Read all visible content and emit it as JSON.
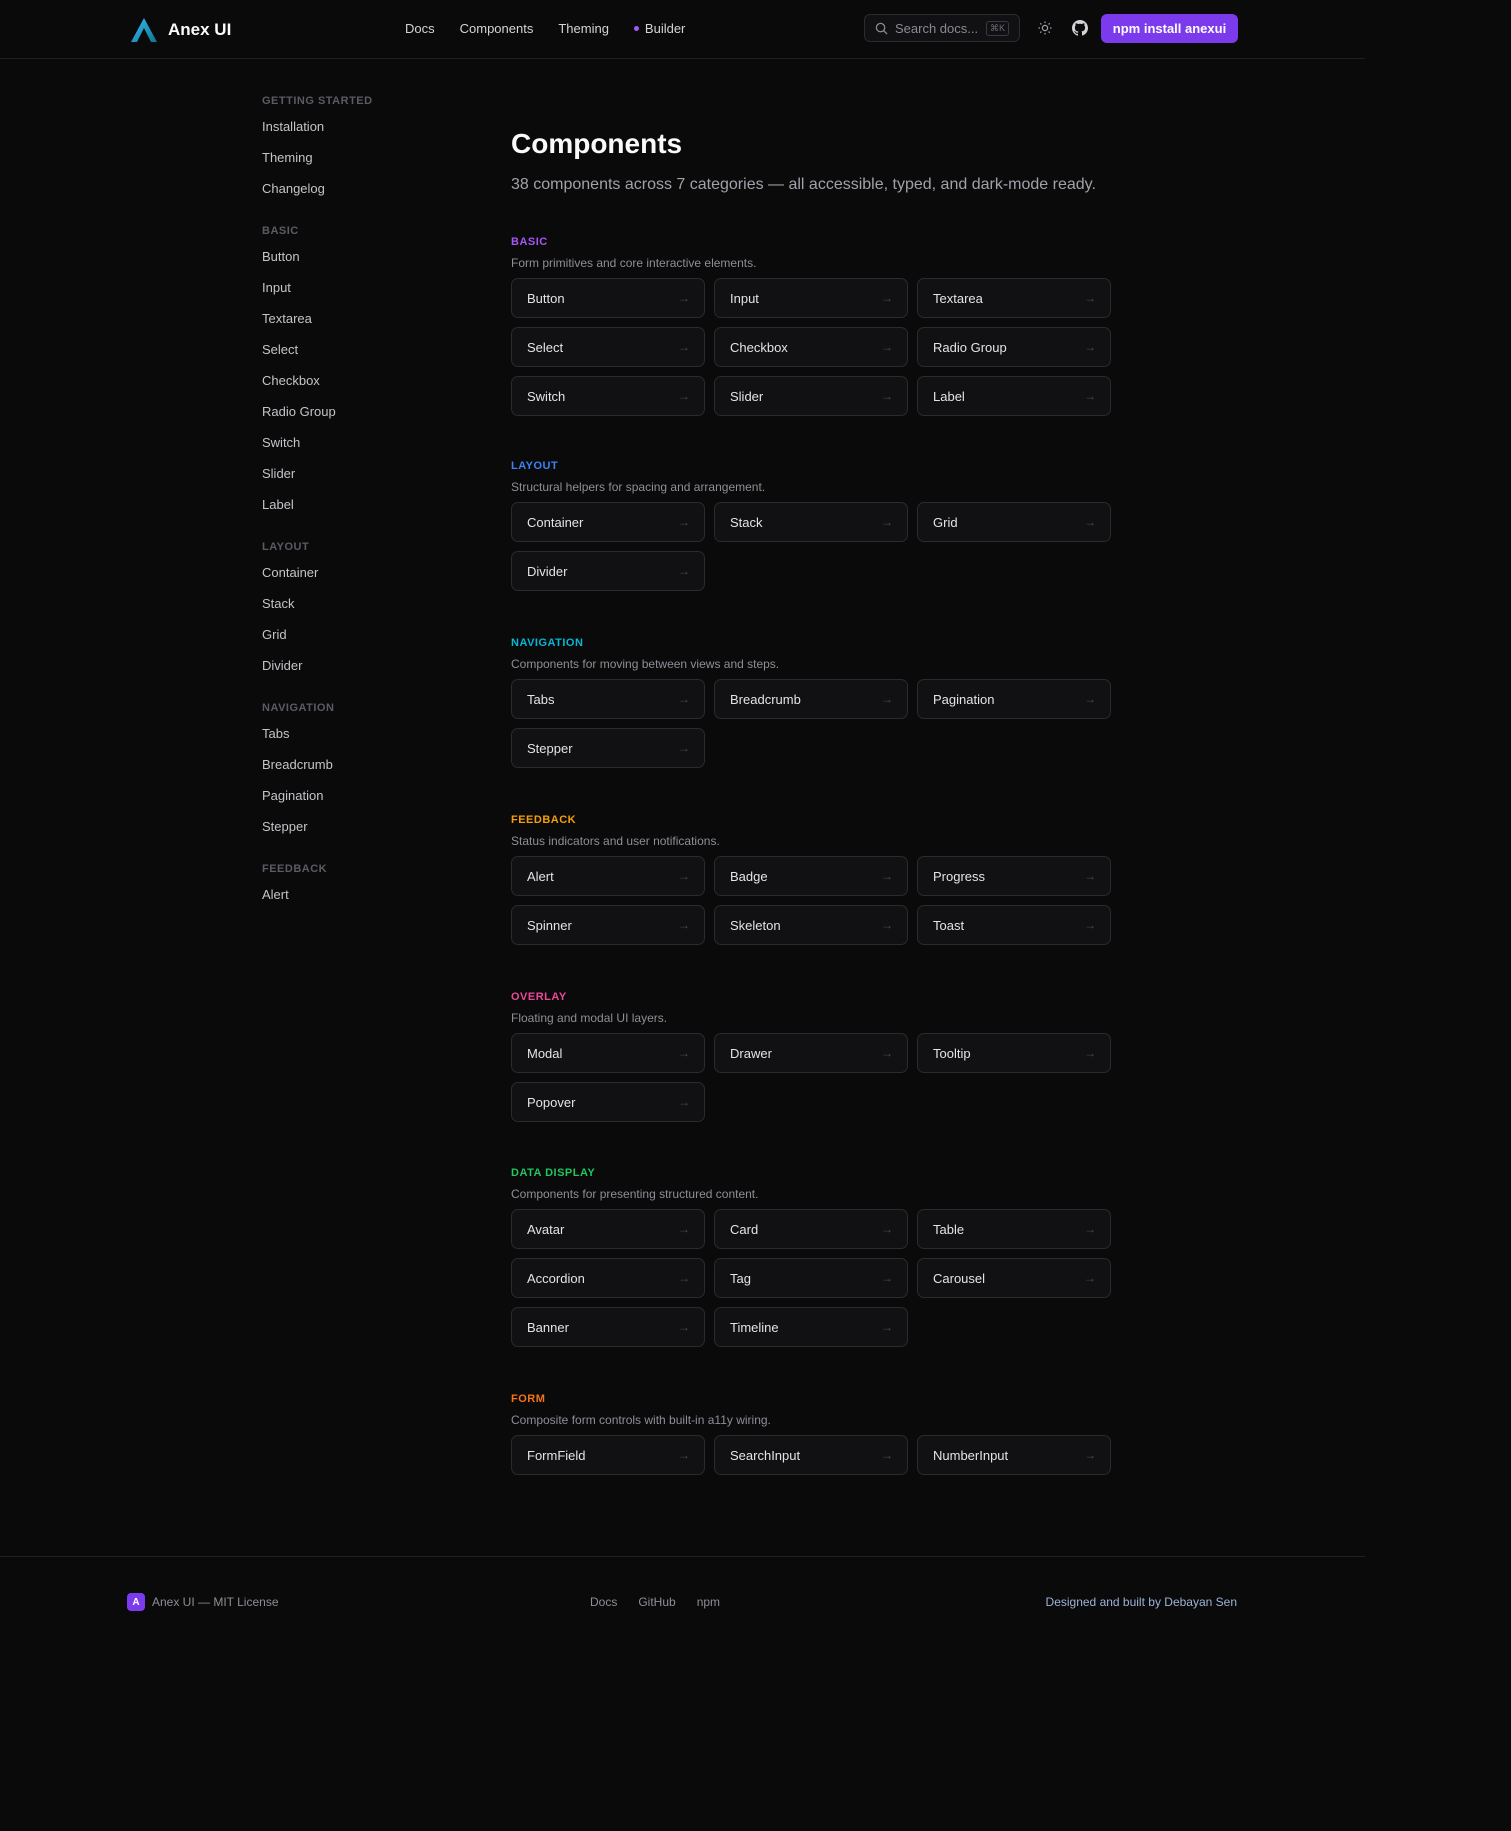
{
  "header": {
    "brand": "Anex UI",
    "nav": [
      "Docs",
      "Components",
      "Theming",
      "Builder"
    ],
    "search_placeholder": "Search docs...",
    "search_shortcut": "⌘K",
    "cta": "npm install anexui"
  },
  "sidebar": {
    "groups": [
      {
        "title": "GETTING STARTED",
        "items": [
          "Installation",
          "Theming",
          "Changelog"
        ]
      },
      {
        "title": "BASIC",
        "items": [
          "Button",
          "Input",
          "Textarea",
          "Select",
          "Checkbox",
          "Radio Group",
          "Switch",
          "Slider",
          "Label"
        ]
      },
      {
        "title": "LAYOUT",
        "items": [
          "Container",
          "Stack",
          "Grid",
          "Divider"
        ]
      },
      {
        "title": "NAVIGATION",
        "items": [
          "Tabs",
          "Breadcrumb",
          "Pagination",
          "Stepper"
        ]
      },
      {
        "title": "FEEDBACK",
        "items": [
          "Alert"
        ]
      }
    ]
  },
  "main": {
    "title": "Components",
    "subtitle": "38 components across 7 categories — all accessible, typed, and dark-mode ready.",
    "sections": [
      {
        "title": "BASIC",
        "color": "#a855f7",
        "description": "Form primitives and core interactive elements.",
        "items": [
          "Button",
          "Input",
          "Textarea",
          "Select",
          "Checkbox",
          "Radio Group",
          "Switch",
          "Slider",
          "Label"
        ]
      },
      {
        "title": "LAYOUT",
        "color": "#3b82f6",
        "description": "Structural helpers for spacing and arrangement.",
        "items": [
          "Container",
          "Stack",
          "Grid",
          "Divider"
        ]
      },
      {
        "title": "NAVIGATION",
        "color": "#06b6d4",
        "description": "Components for moving between views and steps.",
        "items": [
          "Tabs",
          "Breadcrumb",
          "Pagination",
          "Stepper"
        ]
      },
      {
        "title": "FEEDBACK",
        "color": "#f59e0b",
        "description": "Status indicators and user notifications.",
        "items": [
          "Alert",
          "Badge",
          "Progress",
          "Spinner",
          "Skeleton",
          "Toast"
        ]
      },
      {
        "title": "OVERLAY",
        "color": "#ec4899",
        "description": "Floating and modal UI layers.",
        "items": [
          "Modal",
          "Drawer",
          "Tooltip",
          "Popover"
        ]
      },
      {
        "title": "DATA DISPLAY",
        "color": "#22c55e",
        "description": "Components for presenting structured content.",
        "items": [
          "Avatar",
          "Card",
          "Table",
          "Accordion",
          "Tag",
          "Carousel",
          "Banner",
          "Timeline"
        ]
      },
      {
        "title": "FORM",
        "color": "#f97316",
        "description": "Composite form controls with built-in a11y wiring.",
        "items": [
          "FormField",
          "SearchInput",
          "NumberInput"
        ]
      }
    ],
    "arrow": "→"
  },
  "footer": {
    "badge": "A",
    "license": "Anex UI — MIT License",
    "links": [
      "Docs",
      "GitHub",
      "npm"
    ],
    "credit": "Designed and built by Debayan Sen"
  }
}
